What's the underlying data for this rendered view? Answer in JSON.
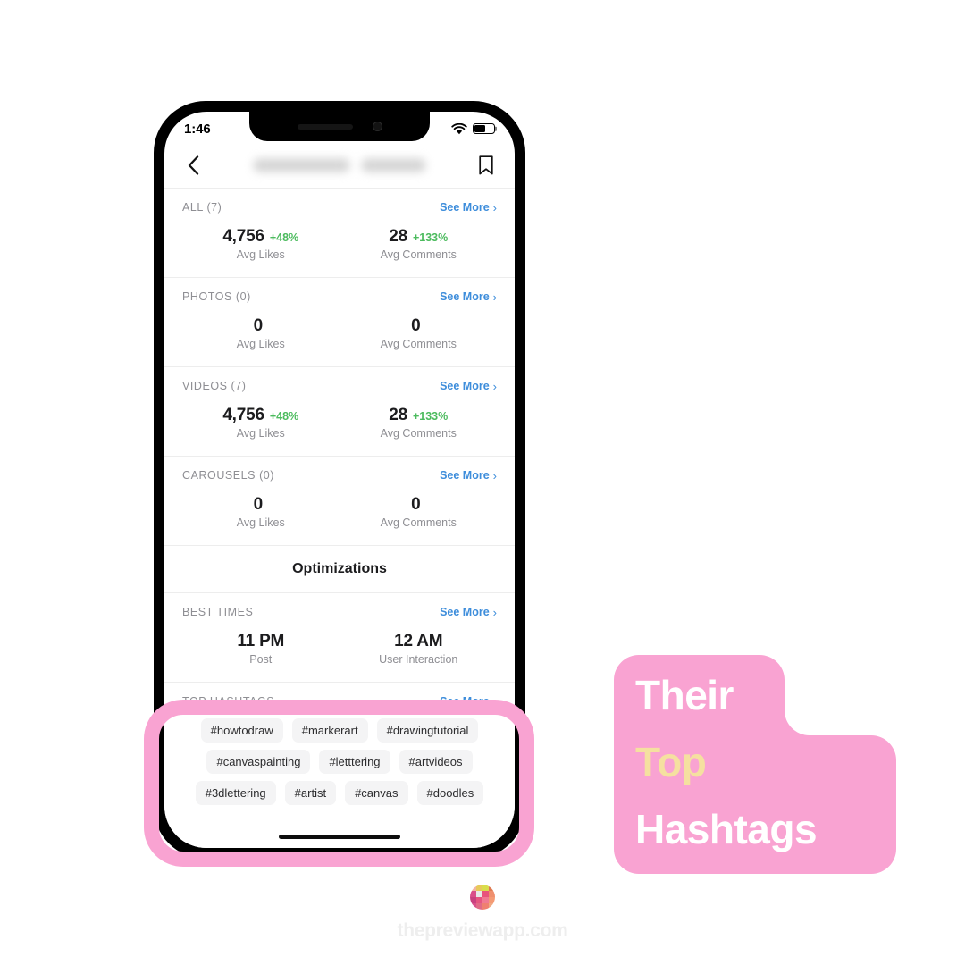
{
  "phone": {
    "status_bar": {
      "time": "1:46",
      "wifi_icon": "wifi-icon",
      "battery_icon": "battery-icon"
    },
    "nav_bar": {
      "back_icon": "chevron-left-icon",
      "title": "",
      "bookmark_icon": "bookmark-icon"
    }
  },
  "see_more_label": "See More",
  "chevron": "›",
  "stats": [
    {
      "label": "ALL (7)",
      "see_more": "See More",
      "metrics": [
        {
          "value": "4,756",
          "delta": "+48%",
          "name": "Avg Likes"
        },
        {
          "value": "28",
          "delta": "+133%",
          "name": "Avg Comments"
        }
      ]
    },
    {
      "label": "PHOTOS (0)",
      "see_more": "See More",
      "metrics": [
        {
          "value": "0",
          "delta": "",
          "name": "Avg Likes"
        },
        {
          "value": "0",
          "delta": "",
          "name": "Avg Comments"
        }
      ]
    },
    {
      "label": "VIDEOS (7)",
      "see_more": "See More",
      "metrics": [
        {
          "value": "4,756",
          "delta": "+48%",
          "name": "Avg Likes"
        },
        {
          "value": "28",
          "delta": "+133%",
          "name": "Avg Comments"
        }
      ]
    },
    {
      "label": "CAROUSELS (0)",
      "see_more": "See More",
      "metrics": [
        {
          "value": "0",
          "delta": "",
          "name": "Avg Likes"
        },
        {
          "value": "0",
          "delta": "",
          "name": "Avg Comments"
        }
      ]
    }
  ],
  "optimizations": {
    "title": "Optimizations"
  },
  "best_times": {
    "label": "BEST TIMES",
    "see_more": "See More",
    "metrics": [
      {
        "value": "11 PM",
        "delta": "",
        "name": "Post"
      },
      {
        "value": "12 AM",
        "delta": "",
        "name": "User Interaction"
      }
    ]
  },
  "top_hashtags": {
    "label": "TOP HASHTAGS",
    "see_more": "See More",
    "rows": [
      [
        "#howtodraw",
        "#markerart",
        "#drawingtutorial"
      ],
      [
        "#canvaspainting",
        "#letttering",
        "#artvideos"
      ],
      [
        "#3dlettering",
        "#artist",
        "#canvas",
        "#doodles"
      ]
    ]
  },
  "callout": {
    "line1": "Their",
    "line2": "Top",
    "line3": "Hashtags"
  },
  "footer": {
    "logo_icon": "preview-app-logo-icon",
    "text": "thepreviewapp.com",
    "logo_colors": [
      "#f2b6a0",
      "#e8c95a",
      "#d9dd4c",
      "#e07a50",
      "#d94f8a",
      "#e8e8e8",
      "#e8547c",
      "#ef8f6e",
      "#c9417f",
      "#e65580",
      "#f07a92",
      "#f49a74",
      "#d94f8a",
      "#e06a86",
      "#ef8070",
      "#f0a882"
    ]
  },
  "colors": {
    "pink": "#f9a3d2",
    "yellow": "#f5e0a0",
    "link_blue": "#3d8ddb",
    "green": "#4cbb5e",
    "gray_label": "#8e8e93"
  }
}
